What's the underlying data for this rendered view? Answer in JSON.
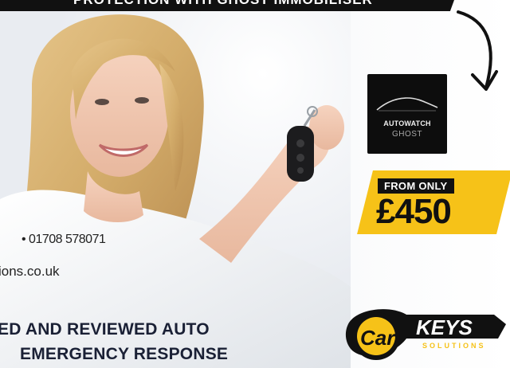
{
  "banner": {
    "text": "PROTECTION WITH GHOST IMMOBILISER"
  },
  "product": {
    "brand": "AUTOWATCH",
    "model": "GHOST",
    "icon": "car-silhouette-icon"
  },
  "price": {
    "label": "FROM ONLY",
    "value": "£450"
  },
  "contact": {
    "phone": "• 01708 578071",
    "website": "ions.co.uk"
  },
  "headline": {
    "line1": "ED AND REVIEWED AUTO",
    "line2": "EMERGENCY RESPONSE"
  },
  "logo": {
    "text1": "Car",
    "text2": "KEYS",
    "text3": "SOLUTIONS"
  },
  "colors": {
    "accent": "#f6c218",
    "dark": "#111111",
    "headline": "#1a2035"
  }
}
